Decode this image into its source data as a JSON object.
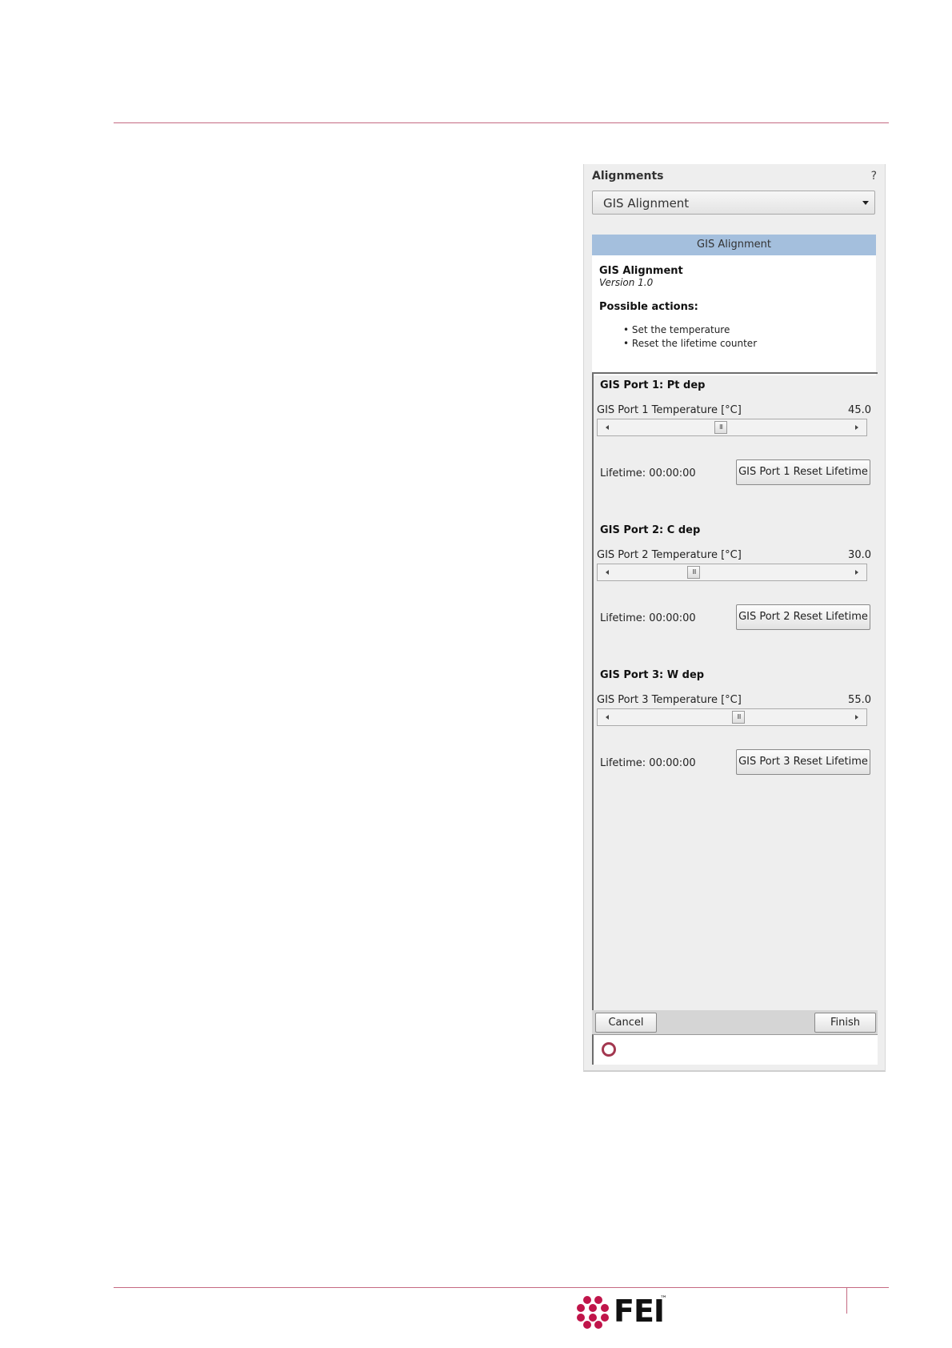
{
  "panel": {
    "title": "Alignments",
    "help": "?",
    "dropdown_value": "GIS Alignment",
    "section_header": "GIS Alignment",
    "info_title": "GIS Alignment",
    "info_version": "Version 1.0",
    "actions_title": "Possible actions:",
    "actions": [
      "Set the temperature",
      "Reset the lifetime counter"
    ]
  },
  "ports": [
    {
      "title": "GIS Port 1: Pt dep",
      "temp_label": "GIS Port 1 Temperature [°C]",
      "temp_value": "45.0",
      "slider_level": 0.45,
      "lifetime": "Lifetime: 00:00:00",
      "reset_label": "GIS Port 1 Reset Lifetime"
    },
    {
      "title": "GIS Port 2: C dep",
      "temp_label": "GIS Port 2 Temperature [°C]",
      "temp_value": "30.0",
      "slider_level": 0.33,
      "lifetime": "Lifetime: 00:00:00",
      "reset_label": "GIS Port 2 Reset Lifetime"
    },
    {
      "title": "GIS Port 3: W dep",
      "temp_label": "GIS Port 3 Temperature [°C]",
      "temp_value": "55.0",
      "slider_level": 0.53,
      "lifetime": "Lifetime: 00:00:00",
      "reset_label": "GIS Port 3 Reset Lifetime"
    }
  ],
  "footer": {
    "cancel": "Cancel",
    "finish": "Finish"
  },
  "brand": {
    "logo_text": "FEI",
    "tm": "™",
    "accent": "#c0154a"
  },
  "colors": {
    "rule": "#c56a82",
    "header_bar": "#a4bfdd"
  }
}
